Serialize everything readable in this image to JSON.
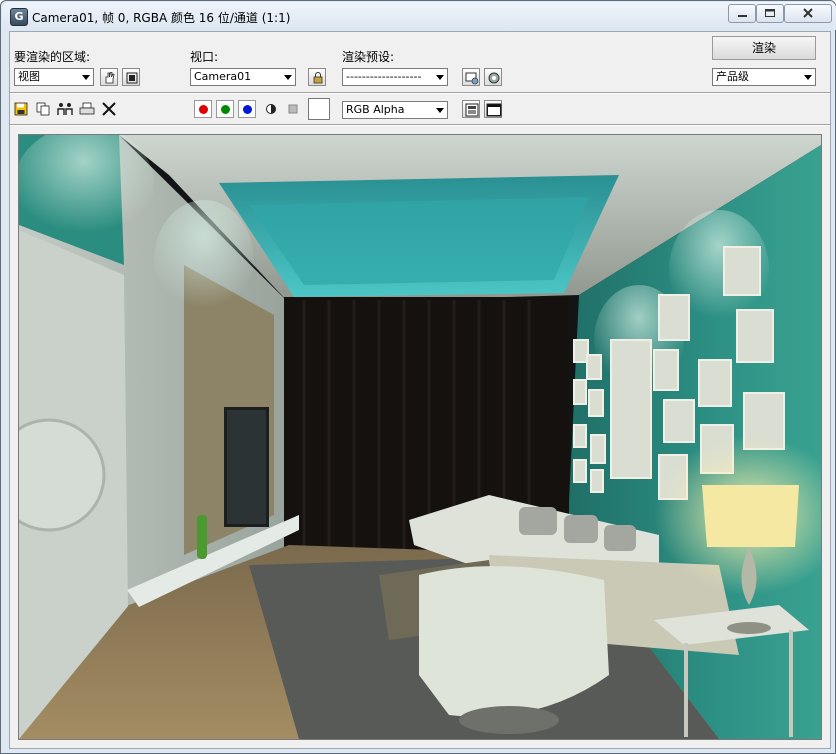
{
  "window": {
    "title": "Camera01, 帧 0, RGBA 颜色 16 位/通道 (1:1)"
  },
  "toolbar": {
    "area_label": "要渲染的区域:",
    "area_value": "视图",
    "viewport_label": "视口:",
    "viewport_value": "Camera01",
    "preset_label": "渲染预设:",
    "preset_value": "-------------------",
    "render_button": "渲染",
    "quality_value": "产品级"
  },
  "display": {
    "channel_value": "RGB Alpha",
    "channels": [
      {
        "name": "red",
        "color": "#e10000"
      },
      {
        "name": "green",
        "color": "#008a00"
      },
      {
        "name": "blue",
        "color": "#0018d6"
      }
    ]
  },
  "colors": {
    "title_bar": "#dde7f1",
    "panel": "#f0f0f0",
    "wall_teal": "#2d9185",
    "ceiling_glow": "#38b6b8",
    "curtain": "#14110f"
  }
}
